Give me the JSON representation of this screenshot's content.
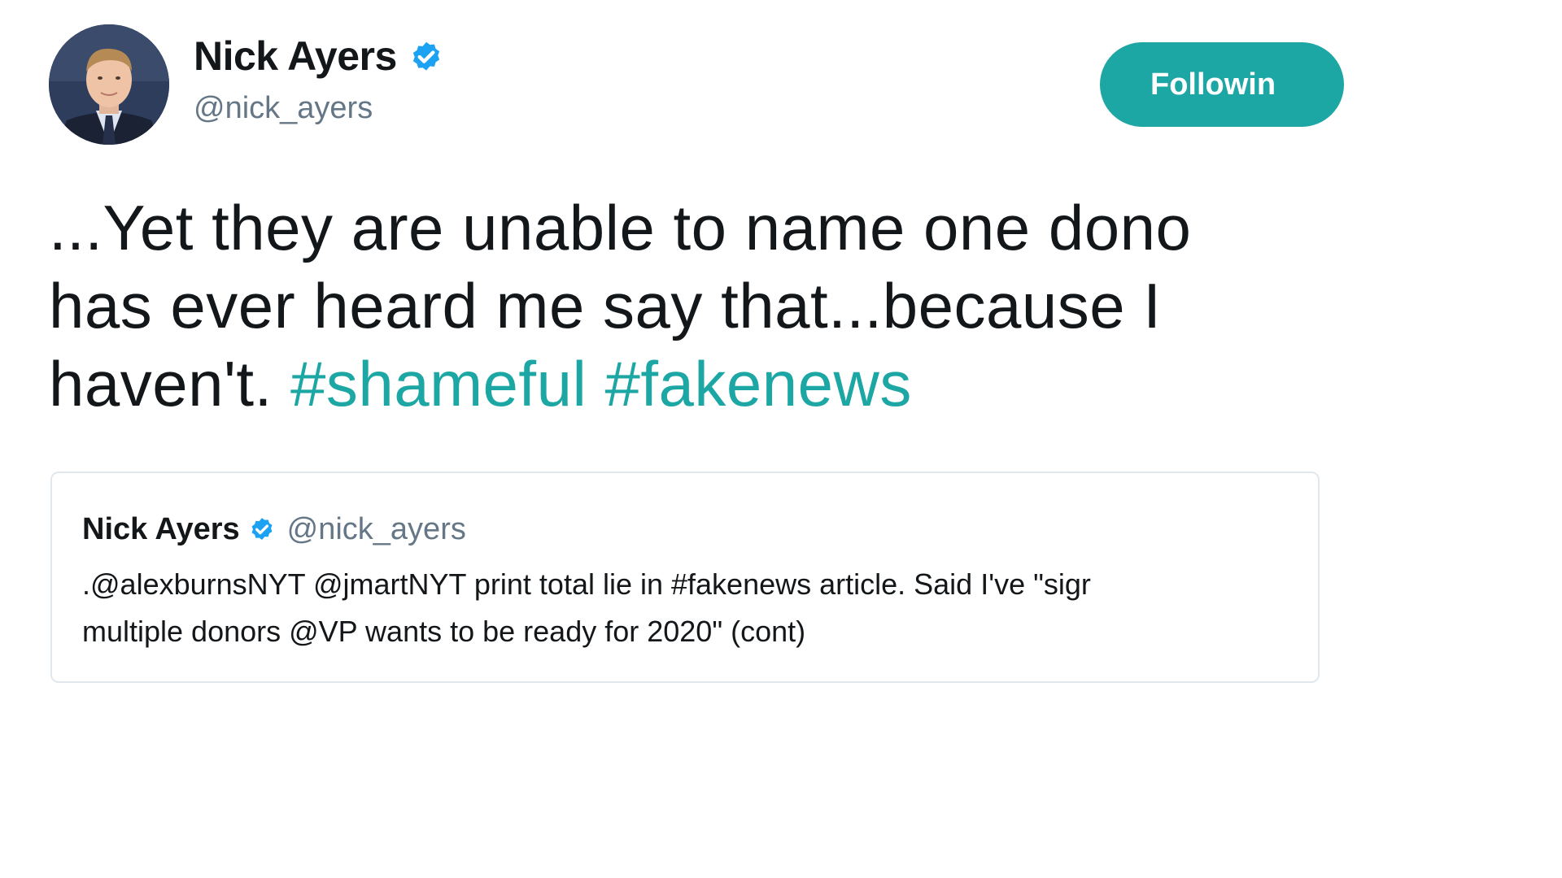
{
  "author": {
    "display_name": "Nick Ayers",
    "handle": "@nick_ayers",
    "verified_icon": "verified-badge-icon",
    "avatar": "profile-photo-avatar"
  },
  "follow_button": {
    "label": "Followin"
  },
  "tweet": {
    "line1": "...Yet they are unable to name one dono",
    "line2": "has ever heard me say that...because I",
    "line3_text": "haven't.",
    "hashtags": [
      "#shameful",
      "#fakenews"
    ]
  },
  "quoted_tweet": {
    "display_name": "Nick Ayers",
    "handle": "@nick_ayers",
    "line1": ".@alexburnsNYT @jmartNYT print total lie in #fakenews article. Said I've \"sigr",
    "line2": "multiple donors @VP wants to be ready for 2020\" (cont)"
  },
  "colors": {
    "accent": "#1ca6a4",
    "verified": "#1da1f2",
    "secondary_text": "#657786",
    "primary_text": "#14171a",
    "border": "#e1e8ed"
  }
}
